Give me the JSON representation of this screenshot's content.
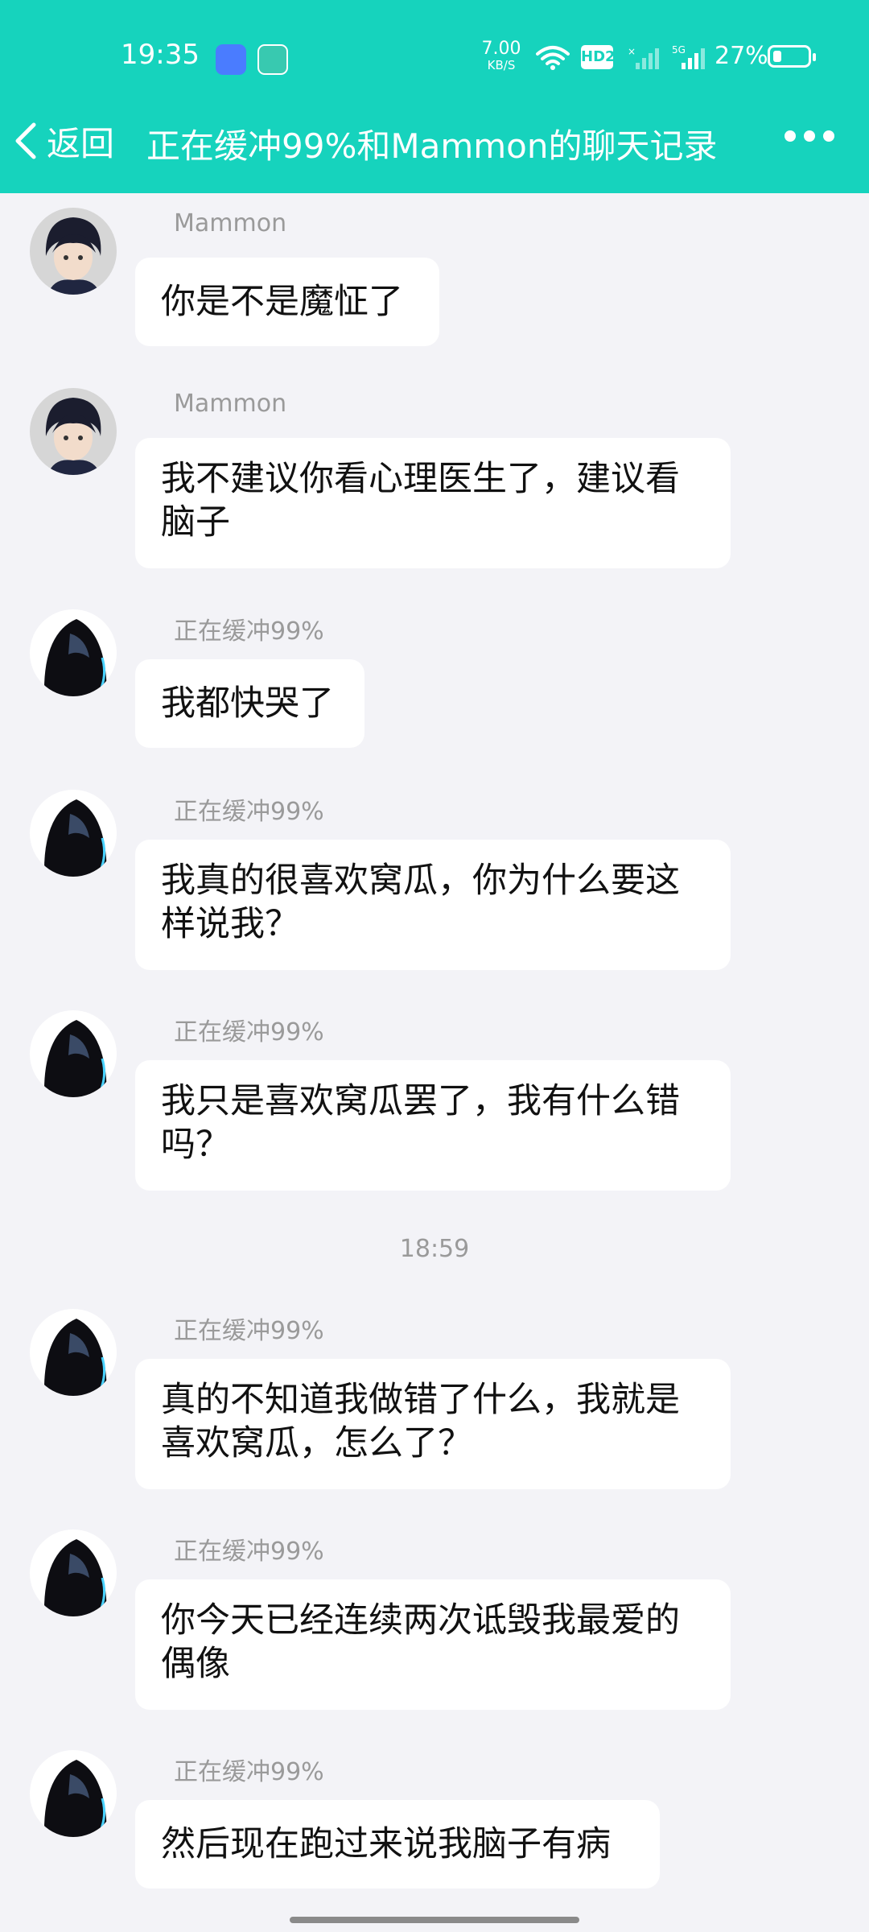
{
  "status_bar": {
    "time": "19:35",
    "net_speed_value": "7.00",
    "net_speed_unit": "KB/S",
    "hd_badge": "HD2",
    "battery_percent": "27%",
    "battery_level": 0.27
  },
  "header": {
    "back_label": "返回",
    "title": "正在缓冲99%和Mammon的聊天记录"
  },
  "messages": [
    {
      "sender": "Mammon",
      "text": "你是不是魔怔了"
    },
    {
      "sender": "Mammon",
      "text": "我不建议你看心理医生了，建议看脑子"
    },
    {
      "sender": "正在缓冲99%",
      "text": "我都快哭了"
    },
    {
      "sender": "正在缓冲99%",
      "text": "我真的很喜欢窝瓜，你为什么要这样说我？"
    },
    {
      "sender": "正在缓冲99%",
      "text": "我只是喜欢窝瓜罢了，我有什么错吗？"
    },
    {
      "timestamp": "18:59"
    },
    {
      "sender": "正在缓冲99%",
      "text": "真的不知道我做错了什么，我就是喜欢窝瓜，怎么了？"
    },
    {
      "sender": "正在缓冲99%",
      "text": "你今天已经连续两次诋毁我最爱的偶像"
    },
    {
      "sender": "正在缓冲99%",
      "text": "然后现在跑过来说我脑子有病"
    }
  ],
  "colors": {
    "header_bg": "#16d3bd",
    "page_bg": "#f3f3f7",
    "bubble_bg": "#ffffff"
  },
  "icons": {
    "back": "chevron-left-icon",
    "more": "more-dots-icon",
    "wifi": "wifi-icon",
    "signal": "cellular-signal-icon",
    "battery": "battery-icon"
  }
}
